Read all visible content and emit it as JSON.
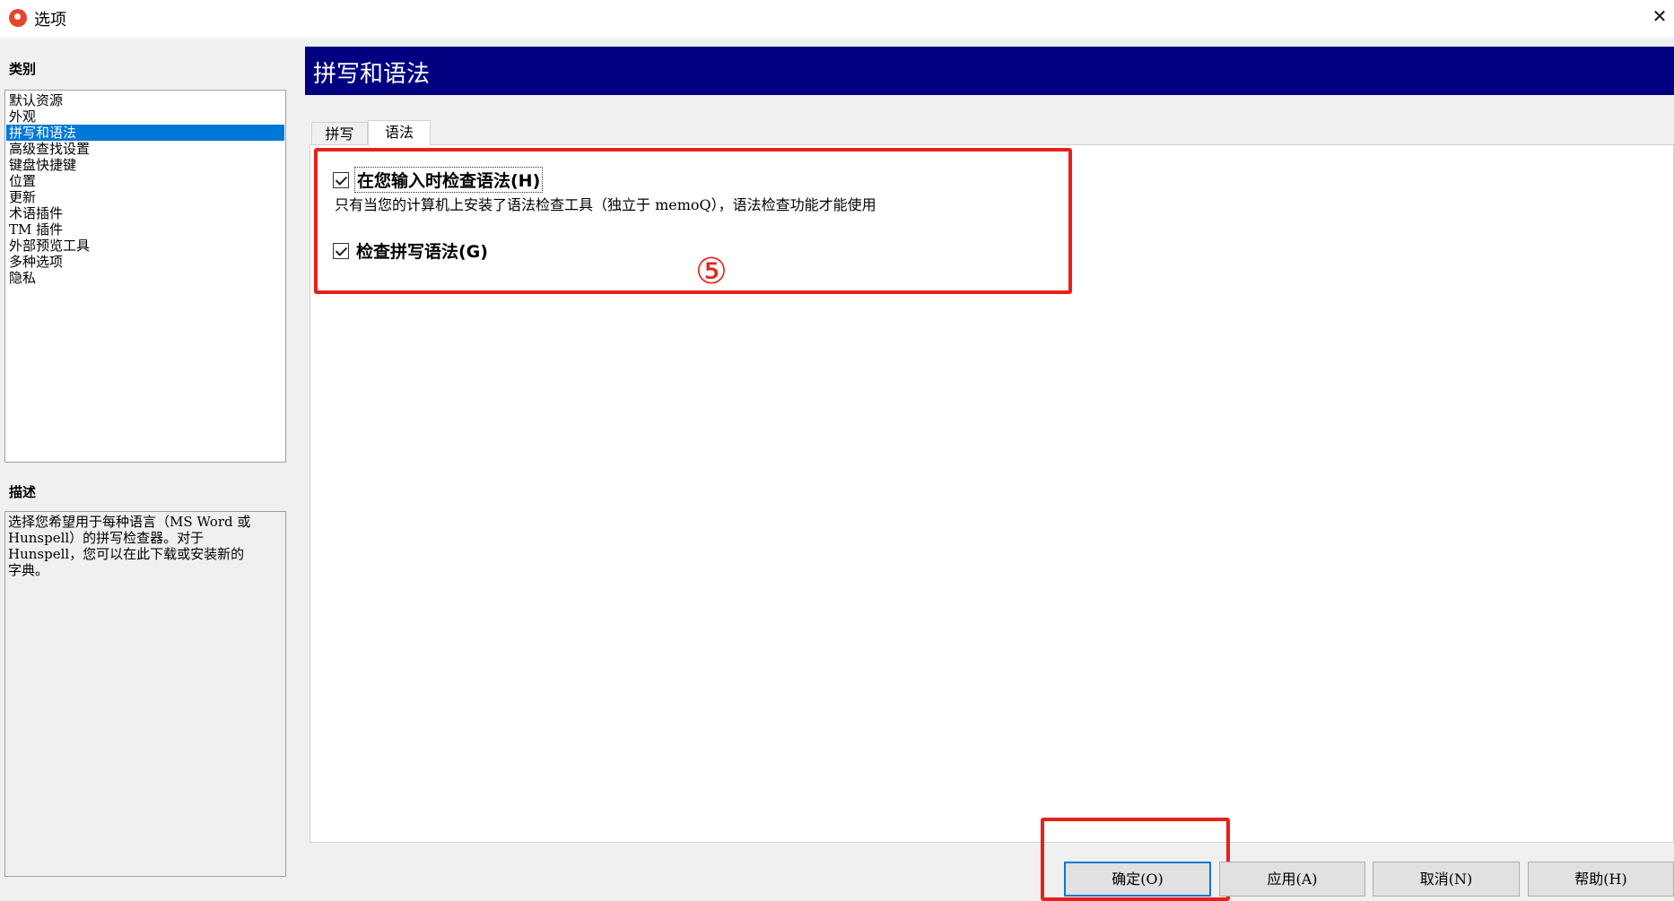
{
  "window": {
    "title": "选项",
    "close_glyph": "✕"
  },
  "categories": {
    "label": "类别",
    "items": [
      {
        "label": "默认资源",
        "selected": false
      },
      {
        "label": "外观",
        "selected": false
      },
      {
        "label": "拼写和语法",
        "selected": true
      },
      {
        "label": "高级查找设置",
        "selected": false
      },
      {
        "label": "键盘快捷键",
        "selected": false
      },
      {
        "label": "位置",
        "selected": false
      },
      {
        "label": "更新",
        "selected": false
      },
      {
        "label": "术语插件",
        "selected": false
      },
      {
        "label": "TM 插件",
        "selected": false
      },
      {
        "label": "外部预览工具",
        "selected": false
      },
      {
        "label": "多种选项",
        "selected": false
      },
      {
        "label": "隐私",
        "selected": false
      }
    ]
  },
  "description": {
    "label": "描述",
    "lines": [
      "选择您希望用于每种语言（MS Word 或",
      "Hunspell）的拼写检查器。对于",
      "Hunspell，您可以在此下载或安装新的",
      "字典。"
    ]
  },
  "main": {
    "header_title": "拼写和语法",
    "tabs": [
      {
        "label": "拼写",
        "active": false
      },
      {
        "label": "语法",
        "active": true
      }
    ],
    "grammar": {
      "check_as_you_type": {
        "label": "在您输入时检查语法(H)",
        "checked": true
      },
      "hint": "只有当您的计算机上安装了语法检查工具（独立于 memoQ），语法检查功能才能使用",
      "check_spelling_grammar": {
        "label": "检查拼写语法(G)",
        "checked": true
      }
    }
  },
  "annotation": {
    "number": "⑤",
    "color": "#e8201b"
  },
  "buttons": {
    "ok": "确定(O)",
    "apply": "应用(A)",
    "cancel": "取消(N)",
    "help": "帮助(H)"
  },
  "colors": {
    "header_bg": "#000080",
    "selection": "#0078d7"
  }
}
